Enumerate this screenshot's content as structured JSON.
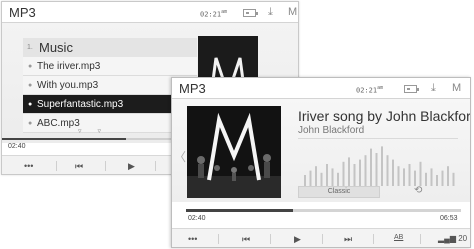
{
  "back_screen": {
    "status": {
      "title": "MP3",
      "time": "02:21",
      "ampm": "am",
      "mode": "M"
    },
    "list": {
      "header_num": "1.",
      "header": "Music",
      "items": [
        {
          "label": "The iriver.mp3"
        },
        {
          "label": "With you.mp3"
        },
        {
          "label": "Superfantastic.mp3"
        },
        {
          "label": "ABC.mp3"
        }
      ],
      "selected_index": 2
    },
    "elapsed": "02:40",
    "progress_fraction": 0.42,
    "controls": {
      "more": "•••",
      "prev": "⏮",
      "play": "▶"
    }
  },
  "front_screen": {
    "status": {
      "title": "MP3",
      "time": "02:21",
      "ampm": "am",
      "mode": "M"
    },
    "song": {
      "title": "Iriver song by John Blackford",
      "artist": "John Blackford"
    },
    "eq_preset": "Classic",
    "elapsed": "02:40",
    "total": "06:53",
    "progress_fraction": 0.39,
    "controls": {
      "more": "•••",
      "prev": "⏮",
      "play": "▶",
      "next": "⏭",
      "ab": "AB",
      "volume": "20"
    },
    "eq_levels": [
      0.25,
      0.35,
      0.45,
      0.3,
      0.5,
      0.4,
      0.3,
      0.55,
      0.65,
      0.5,
      0.6,
      0.7,
      0.85,
      0.75,
      0.9,
      0.7,
      0.6,
      0.45,
      0.4,
      0.5,
      0.35,
      0.55,
      0.3,
      0.4,
      0.25,
      0.35,
      0.45,
      0.3
    ],
    "colors": {
      "accent": "#444444",
      "selected_bg": "#1c1c1c"
    }
  }
}
